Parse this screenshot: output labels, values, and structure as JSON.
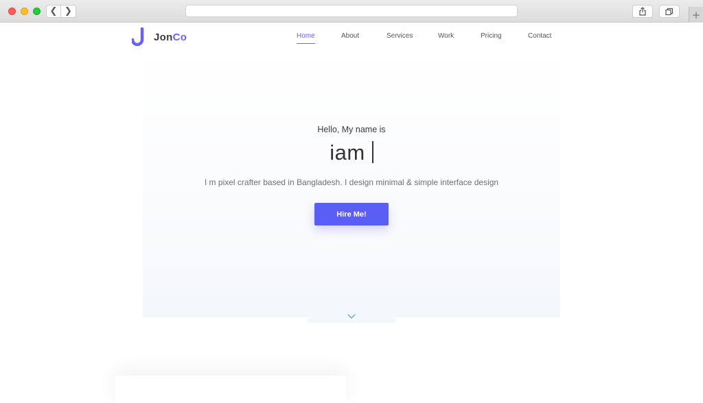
{
  "browser": {
    "url": "",
    "back_glyph": "❮",
    "forward_glyph": "❯",
    "new_tab_glyph": "+",
    "icons": [
      "share-icon",
      "tabs-icon"
    ]
  },
  "brand": {
    "name_part1": "Jon",
    "name_part2": "Co",
    "accent_color": "#6a61f0"
  },
  "nav": {
    "items": [
      {
        "label": "Home",
        "active": true
      },
      {
        "label": "About",
        "active": false
      },
      {
        "label": "Services",
        "active": false
      },
      {
        "label": "Work",
        "active": false
      },
      {
        "label": "Pricing",
        "active": false
      },
      {
        "label": "Contact",
        "active": false
      }
    ]
  },
  "hero": {
    "greeting": "Hello, My name is",
    "headline": "iam",
    "bio": "I m pixel crafter based in Bangladesh. I design minimal & simple interface design",
    "cta_label": "Hire Me!",
    "cta_color": "#5b5ef5"
  }
}
